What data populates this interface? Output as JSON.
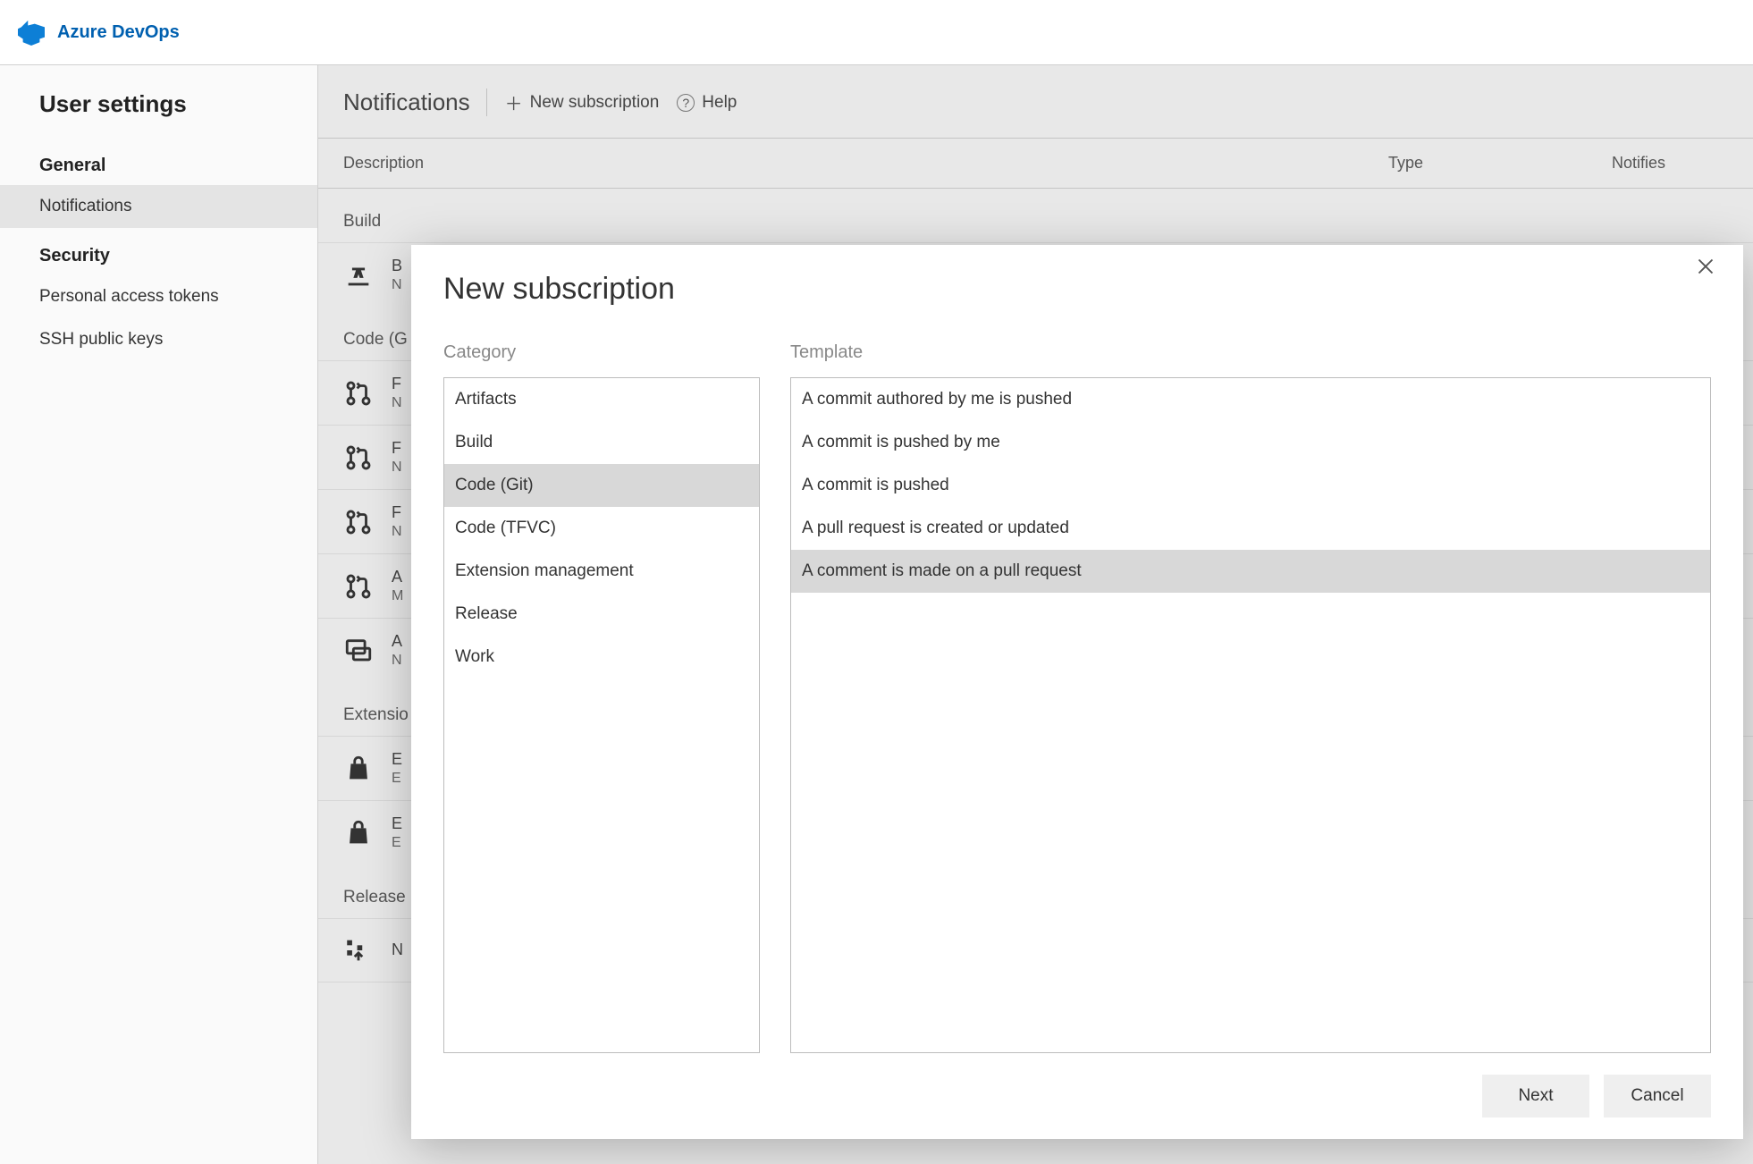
{
  "brand": "Azure DevOps",
  "sidebar": {
    "title": "User settings",
    "groups": [
      {
        "heading": "General",
        "items": [
          {
            "label": "Notifications",
            "selected": true
          }
        ]
      },
      {
        "heading": "Security",
        "items": [
          {
            "label": "Personal access tokens"
          },
          {
            "label": "SSH public keys"
          }
        ]
      }
    ]
  },
  "page": {
    "title": "Notifications",
    "new_sub_label": "New subscription",
    "help_label": "Help",
    "columns": {
      "description": "Description",
      "type": "Type",
      "notifies": "Notifies"
    },
    "sections": [
      {
        "label": "Build",
        "rows": [
          {
            "icon": "build",
            "line1": "B",
            "line2": "N"
          }
        ]
      },
      {
        "label": "Code (G",
        "rows": [
          {
            "icon": "pr",
            "line1": "F",
            "line2": "N"
          },
          {
            "icon": "pr",
            "line1": "F",
            "line2": "N"
          },
          {
            "icon": "pr",
            "line1": "F",
            "line2": "N"
          },
          {
            "icon": "pr",
            "line1": "A",
            "line2": "M"
          },
          {
            "icon": "chat",
            "line1": "A",
            "line2": "N"
          }
        ]
      },
      {
        "label": "Extensio",
        "rows": [
          {
            "icon": "bag",
            "line1": "E",
            "line2": "E"
          },
          {
            "icon": "bag",
            "line1": "E",
            "line2": "E"
          }
        ]
      },
      {
        "label": "Release",
        "rows": [
          {
            "icon": "release",
            "line1": "N",
            "line2": ""
          }
        ]
      }
    ]
  },
  "modal": {
    "title": "New subscription",
    "category": {
      "label": "Category",
      "items": [
        {
          "label": "Artifacts"
        },
        {
          "label": "Build"
        },
        {
          "label": "Code (Git)",
          "selected": true
        },
        {
          "label": "Code (TFVC)"
        },
        {
          "label": "Extension management"
        },
        {
          "label": "Release"
        },
        {
          "label": "Work"
        }
      ]
    },
    "template": {
      "label": "Template",
      "items": [
        {
          "label": "A commit authored by me is pushed"
        },
        {
          "label": "A commit is pushed by me"
        },
        {
          "label": "A commit is pushed"
        },
        {
          "label": "A pull request is created or updated"
        },
        {
          "label": "A comment is made on a pull request",
          "selected": true
        }
      ]
    },
    "buttons": {
      "next": "Next",
      "cancel": "Cancel"
    }
  }
}
